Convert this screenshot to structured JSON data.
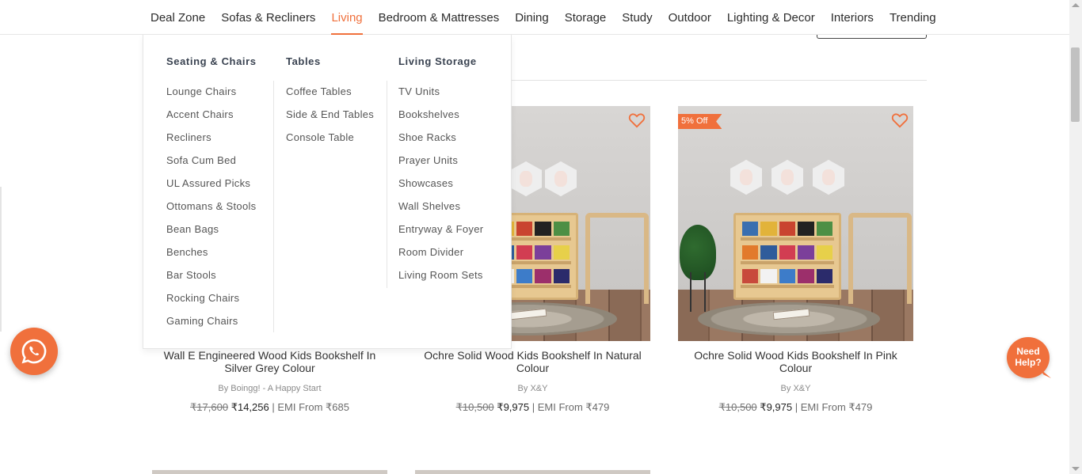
{
  "nav": {
    "items": [
      "Deal Zone",
      "Sofas & Recliners",
      "Living",
      "Bedroom & Mattresses",
      "Dining",
      "Storage",
      "Study",
      "Outdoor",
      "Lighting & Decor",
      "Interiors",
      "Trending"
    ],
    "active": "Living"
  },
  "mega_menu": {
    "seating": {
      "heading": "Seating & Chairs",
      "items": [
        "Lounge Chairs",
        "Accent Chairs",
        "Recliners",
        "Sofa Cum Bed",
        "UL Assured Picks",
        "Ottomans & Stools",
        "Bean Bags",
        "Benches",
        "Bar Stools",
        "Rocking Chairs",
        "Gaming Chairs"
      ]
    },
    "tables": {
      "heading": "Tables",
      "items": [
        "Coffee Tables",
        "Side & End Tables",
        "Console Table"
      ]
    },
    "storage": {
      "heading": "Living Storage",
      "items": [
        "TV Units",
        "Bookshelves",
        "Shoe Racks",
        "Prayer Units",
        "Showcases",
        "Wall Shelves",
        "Entryway & Foyer",
        "Room Divider",
        "Living Room Sets"
      ]
    }
  },
  "products": [
    {
      "title": "Wall E Engineered Wood Kids Bookshelf In Silver Grey Colour",
      "brand": "By Boingg! - A Happy Start",
      "mrp": "₹17,600",
      "price": "₹14,256",
      "emi": "| EMI From ₹685",
      "badge": ""
    },
    {
      "title": "Ochre Solid Wood Kids Bookshelf In Natural Colour",
      "brand": "By X&Y",
      "mrp": "₹10,500",
      "price": "₹9,975",
      "emi": "| EMI From ₹479",
      "badge": ""
    },
    {
      "title": "Ochre Solid Wood Kids Bookshelf In Pink Colour",
      "brand": "By X&Y",
      "mrp": "₹10,500",
      "price": "₹9,975",
      "emi": "| EMI From ₹479",
      "badge": "5% Off"
    }
  ],
  "need_help": {
    "line1": "Need",
    "line2": "Help?"
  },
  "colors": {
    "accent": "#f0703c",
    "text": "#333333",
    "heading": "#3a4351"
  },
  "icons": {
    "whatsapp": "whatsapp-icon",
    "wishlist": "heart-icon"
  }
}
